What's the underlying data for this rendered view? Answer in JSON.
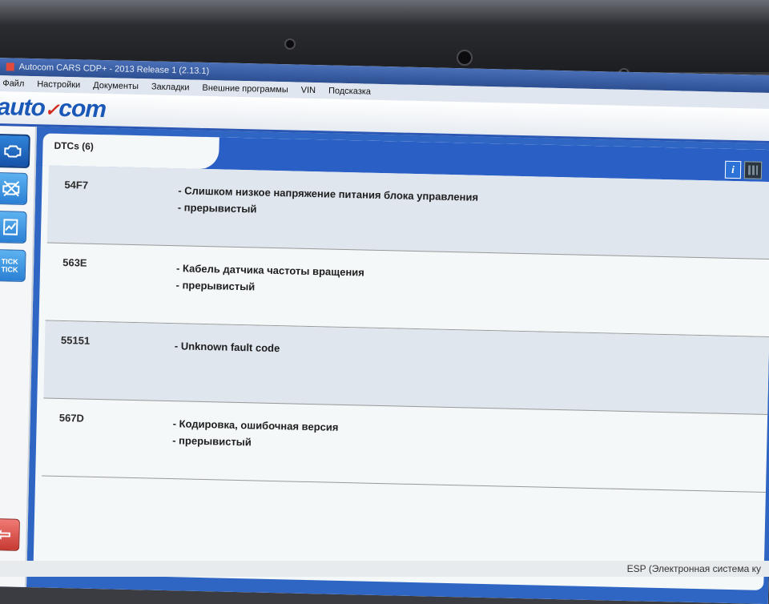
{
  "camera_label": "",
  "window": {
    "title": "Autocom CARS CDP+ - 2013 Release 1 (2.13.1)"
  },
  "menu": [
    "Файл",
    "Настройки",
    "Документы",
    "Закладки",
    "Внешние программы",
    "VIN",
    "Подсказка"
  ],
  "logo": {
    "left": "auto",
    "right": "com"
  },
  "sidebar": {
    "buttons": [
      {
        "name": "engine-icon",
        "label": ""
      },
      {
        "name": "clear-dtc-icon",
        "label": ""
      },
      {
        "name": "live-data-icon",
        "label": ""
      },
      {
        "name": "tick-tick-icon",
        "label": "TICK TICK"
      },
      {
        "name": "back-arrow-icon",
        "label": "⇦"
      }
    ]
  },
  "panel": {
    "tab_title": "DTCs (6)",
    "info_label": "i"
  },
  "dtcs": [
    {
      "code": "54F7",
      "lines": [
        "- Слишком низкое напряжение питания блока управления",
        "- прерывистый"
      ]
    },
    {
      "code": "563E",
      "lines": [
        "- Кабель датчика частоты вращения",
        "- прерывистый"
      ]
    },
    {
      "code": "55151",
      "lines": [
        "- Unknown fault code",
        ""
      ]
    },
    {
      "code": "567D",
      "lines": [
        "- Кодировка, ошибочная версия",
        "- прерывистый"
      ]
    }
  ],
  "bottom_strip": {
    "text": "ESP (Электронная система ку"
  },
  "colors": {
    "accent": "#2a5fc6",
    "row_shade": "#dfe6ee",
    "logo": "#1a58b8"
  }
}
